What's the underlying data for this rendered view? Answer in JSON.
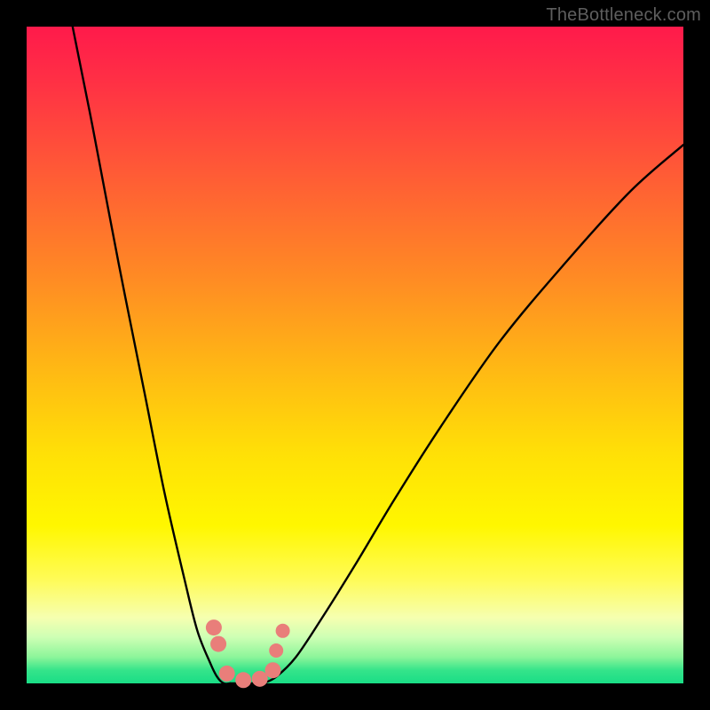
{
  "watermark": "TheBottleneck.com",
  "chart_data": {
    "type": "line",
    "title": "",
    "xlabel": "",
    "ylabel": "",
    "xlim": [
      0,
      100
    ],
    "ylim": [
      0,
      100
    ],
    "grid": false,
    "legend": false,
    "background_gradient": {
      "top_color": "#ff1a4b",
      "mid_color": "#fff700",
      "bottom_color": "#19dd86"
    },
    "series": [
      {
        "name": "left-curve",
        "x": [
          7,
          10,
          14,
          18,
          21,
          24,
          26,
          28,
          29,
          30,
          31
        ],
        "y": [
          100,
          85,
          64,
          44,
          29,
          16,
          8,
          3,
          1,
          0,
          0
        ],
        "stroke": "#000000"
      },
      {
        "name": "right-curve",
        "x": [
          36,
          38,
          41,
          45,
          50,
          56,
          63,
          72,
          82,
          92,
          100
        ],
        "y": [
          0,
          1,
          4,
          10,
          18,
          28,
          39,
          52,
          64,
          75,
          82
        ],
        "stroke": "#000000"
      },
      {
        "name": "valley-floor",
        "x": [
          31,
          33,
          35,
          36
        ],
        "y": [
          0,
          0,
          0,
          0
        ],
        "stroke": "#000000"
      }
    ],
    "markers": [
      {
        "name": "left-dot-upper",
        "x": 28.5,
        "y": 8.5,
        "color": "#e97e7a",
        "r": 9
      },
      {
        "name": "left-dot-lower",
        "x": 29.2,
        "y": 6.0,
        "color": "#e97e7a",
        "r": 9
      },
      {
        "name": "right-dot-upper",
        "x": 39.0,
        "y": 8.0,
        "color": "#e97e7a",
        "r": 8
      },
      {
        "name": "right-dot-lower",
        "x": 38.0,
        "y": 5.0,
        "color": "#e97e7a",
        "r": 8
      },
      {
        "name": "valley-dot-1",
        "x": 30.5,
        "y": 1.5,
        "color": "#e97e7a",
        "r": 9
      },
      {
        "name": "valley-dot-2",
        "x": 33.0,
        "y": 0.5,
        "color": "#e97e7a",
        "r": 9
      },
      {
        "name": "valley-dot-3",
        "x": 35.5,
        "y": 0.7,
        "color": "#e97e7a",
        "r": 9
      },
      {
        "name": "valley-dot-4",
        "x": 37.5,
        "y": 2.0,
        "color": "#e97e7a",
        "r": 9
      }
    ]
  }
}
